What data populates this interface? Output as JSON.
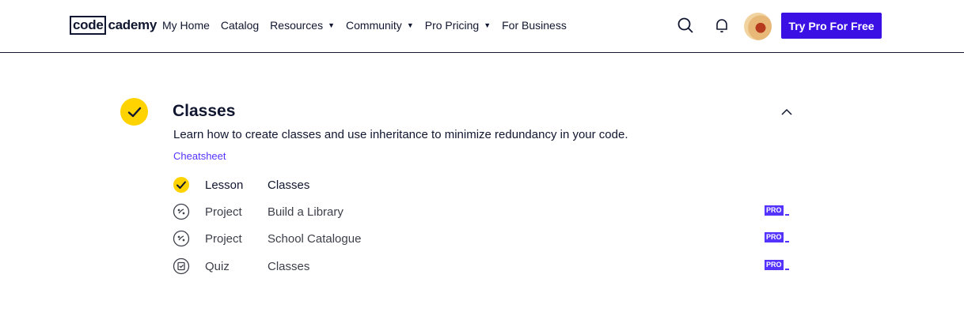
{
  "header": {
    "logo_code": "code",
    "logo_rest": "cademy",
    "nav": [
      {
        "label": "My Home",
        "has_caret": false
      },
      {
        "label": "Catalog",
        "has_caret": false
      },
      {
        "label": "Resources",
        "has_caret": true
      },
      {
        "label": "Community",
        "has_caret": true
      },
      {
        "label": "Pro Pricing",
        "has_caret": true
      },
      {
        "label": "For Business",
        "has_caret": false
      }
    ],
    "caret_glyph": "▼",
    "cta_label": "Try Pro For Free",
    "icons": [
      "search-icon",
      "bell-icon"
    ]
  },
  "module": {
    "title": "Classes",
    "description": "Learn how to create classes and use inheritance to minimize redundancy in your code.",
    "cheatsheet_label": "Cheatsheet",
    "completed": true,
    "items": [
      {
        "type": "Lesson",
        "name": "Classes",
        "completed": true,
        "pro": false
      },
      {
        "type": "Project",
        "name": "Build a Library",
        "completed": false,
        "pro": true
      },
      {
        "type": "Project",
        "name": "School Catalogue",
        "completed": false,
        "pro": true
      },
      {
        "type": "Quiz",
        "name": "Classes",
        "completed": false,
        "pro": true
      }
    ],
    "pro_label": "PRO"
  },
  "colors": {
    "accent": "#3a10e5",
    "check_yellow": "#ffd300",
    "link": "#5533ff",
    "text": "#10162f"
  }
}
